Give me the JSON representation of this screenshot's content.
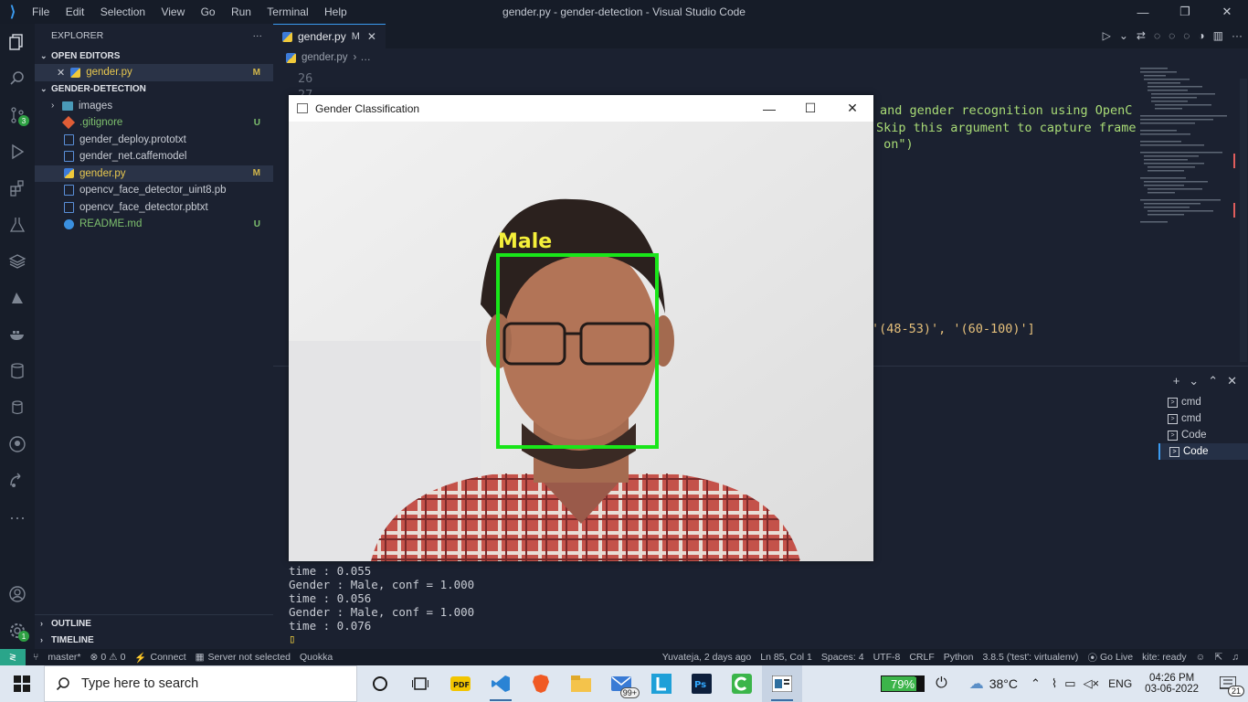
{
  "window": {
    "title": "gender.py - gender-detection - Visual Studio Code",
    "menu": [
      "File",
      "Edit",
      "Selection",
      "View",
      "Go",
      "Run",
      "Terminal",
      "Help"
    ]
  },
  "activity_bar": {
    "scm_badge": "3",
    "settings_badge": "1"
  },
  "explorer": {
    "title": "EXPLORER",
    "more": "···",
    "open_editors_label": "OPEN EDITORS",
    "open_editors": [
      {
        "name": "gender.py",
        "status": "M"
      }
    ],
    "project_label": "GENDER-DETECTION",
    "files": [
      {
        "name": "images",
        "type": "folder",
        "status": ""
      },
      {
        "name": ".gitignore",
        "type": "git",
        "status": "U"
      },
      {
        "name": "gender_deploy.prototxt",
        "type": "file",
        "status": ""
      },
      {
        "name": "gender_net.caffemodel",
        "type": "file",
        "status": ""
      },
      {
        "name": "gender.py",
        "type": "python",
        "status": "M"
      },
      {
        "name": "opencv_face_detector_uint8.pb",
        "type": "file",
        "status": ""
      },
      {
        "name": "opencv_face_detector.pbtxt",
        "type": "file",
        "status": ""
      },
      {
        "name": "README.md",
        "type": "info",
        "status": "U"
      }
    ],
    "outline_label": "OUTLINE",
    "timeline_label": "TIMELINE"
  },
  "editor": {
    "tab_label": "gender.py",
    "tab_status": "M",
    "breadcrumb_file": "gender.py",
    "breadcrumb_more": "…",
    "line_numbers": [
      "26",
      "27"
    ],
    "visible_code": [
      "and gender recognition using OpenC",
      "Skip this argument to capture frame",
      " on\")",
      "'(48-53)', '(60-100)']"
    ]
  },
  "gender_window": {
    "title": "Gender Classification",
    "detection_label": "Male",
    "box_color": "#19e619",
    "label_color": "#f5f03a"
  },
  "terminal": {
    "lines": [
      "time : 0.055",
      "Gender : Male, conf = 1.000",
      "time : 0.056",
      "Gender : Male, conf = 1.000",
      "time : 0.076"
    ],
    "cursor": "▯",
    "sessions": [
      "cmd",
      "cmd",
      "Code",
      "Code"
    ],
    "active_session": 3
  },
  "status_bar": {
    "branch": "master*",
    "problems": "0",
    "warnings": "0",
    "connect": "Connect",
    "server": "Server not selected",
    "quokka": "Quokka",
    "blame": "Yuvateja, 2 days ago",
    "position": "Ln 85, Col 1",
    "spaces": "Spaces: 4",
    "encoding": "UTF-8",
    "eol": "CRLF",
    "language": "Python",
    "interpreter": "3.8.5 ('test': virtualenv)",
    "go_live": "Go Live",
    "kite": "kite: ready"
  },
  "taskbar": {
    "search_placeholder": "Type here to search",
    "mail_badge": "99+",
    "battery": "79%",
    "temperature": "38°C",
    "language": "ENG",
    "time": "04:26 PM",
    "date": "03-06-2022",
    "notifications": "21"
  }
}
